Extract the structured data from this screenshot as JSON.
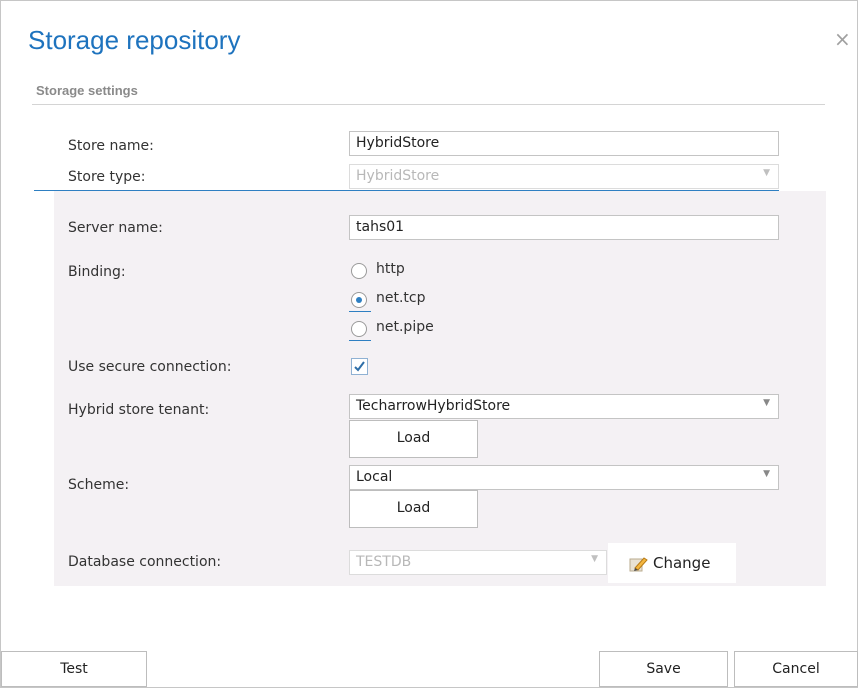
{
  "dialog": {
    "title": "Storage repository",
    "close_glyph": "×",
    "section": "Storage settings"
  },
  "store_name": {
    "label": "Store name:",
    "value": "HybridStore"
  },
  "store_type": {
    "label": "Store type:",
    "value": "HybridStore"
  },
  "server_name": {
    "label": "Server name:",
    "value": "tahs01"
  },
  "binding": {
    "label": "Binding:",
    "options": [
      "http",
      "net.tcp",
      "net.pipe"
    ],
    "selected": "net.tcp"
  },
  "secure_connection": {
    "label": "Use secure connection:",
    "checked": true
  },
  "tenant": {
    "label": "Hybrid store tenant:",
    "value": "TecharrowHybridStore",
    "load_label": "Load"
  },
  "scheme": {
    "label": "Scheme:",
    "value": "Local",
    "load_label": "Load"
  },
  "database": {
    "label": "Database connection:",
    "value": "TESTDB",
    "change_label": "Change"
  },
  "footer": {
    "test_label": "Test",
    "save_label": "Save",
    "cancel_label": "Cancel"
  },
  "colors": {
    "accent": "#1e73be",
    "panel": "#f4f1f4",
    "border": "#c4c4c4"
  },
  "icons": [
    "close-icon",
    "dropdown-arrow-icon",
    "radio-icon",
    "checkbox-check-icon",
    "pencil-icon"
  ]
}
